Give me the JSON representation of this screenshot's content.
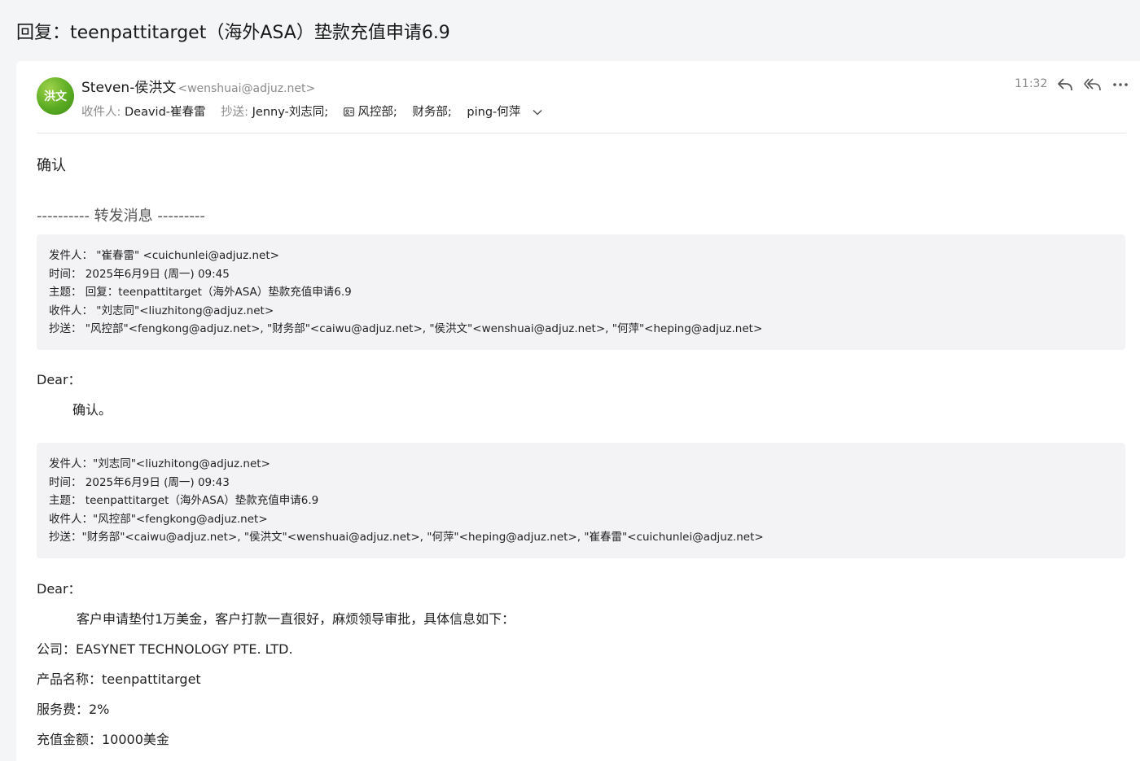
{
  "subject": "回复：teenpattitarget（海外ASA）垫款充值申请6.9",
  "header": {
    "avatar_text": "洪文",
    "sender_name": "Steven-侯洪文",
    "sender_email": "<wenshuai@adjuz.net>",
    "to_label": "收件人:",
    "to_value": "Deavid-崔春雷",
    "cc_label": "抄送:",
    "cc_1": "Jenny-刘志同;",
    "cc_2": "风控部;",
    "cc_3": "财务部;",
    "cc_4": "ping-何萍",
    "time": "11:32",
    "icons": [
      "reply-icon",
      "reply-all-icon",
      "more-icon",
      "group-icon",
      "chevron-down-icon"
    ]
  },
  "body": {
    "reply": "确认",
    "forward_marker": "---------- 转发消息 ---------",
    "quote1": {
      "from": "发件人： \"崔春雷\" <cuichunlei@adjuz.net>",
      "time": "时间： 2025年6月9日 (周一) 09:45",
      "subject": "主题： 回复：teenpattitarget（海外ASA）垫款充值申请6.9",
      "to": "收件人： \"刘志同\"<liuzhitong@adjuz.net>",
      "cc": "抄送： \"风控部\"<fengkong@adjuz.net>, \"财务部\"<caiwu@adjuz.net>, \"侯洪文\"<wenshuai@adjuz.net>, \"何萍\"<heping@adjuz.net>"
    },
    "dear1": "Dear：",
    "confirm2": "确认。",
    "quote2": {
      "from": "发件人：\"刘志同\"<liuzhitong@adjuz.net>",
      "time": "时间： 2025年6月9日 (周一) 09:43",
      "subject": "主题： teenpattitarget（海外ASA）垫款充值申请6.9",
      "to": "收件人：\"风控部\"<fengkong@adjuz.net>",
      "cc": "抄送：\"财务部\"<caiwu@adjuz.net>, \"侯洪文\"<wenshuai@adjuz.net>, \"何萍\"<heping@adjuz.net>, \"崔春雷\"<cuichunlei@adjuz.net>"
    },
    "dear2": "Dear：",
    "request": "客户申请垫付1万美金，客户打款一直很好，麻烦领导审批，具体信息如下：",
    "company": "公司：EASYNET TECHNOLOGY PTE. LTD.",
    "product": "产品名称：teenpattitarget",
    "fee": "服务费：2%",
    "amount": "充值金额：10000美金"
  },
  "colors": {
    "avatar": "#5aab22",
    "muted": "#8a8a8a",
    "quote_bg": "#f3f3f5"
  }
}
